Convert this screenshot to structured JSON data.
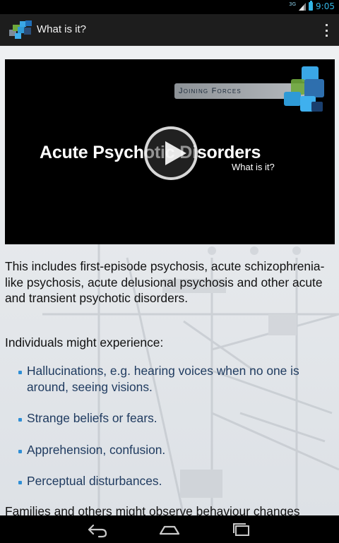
{
  "status_bar": {
    "network_label": "3G",
    "time": "9:05",
    "accent_color": "#33b5e5"
  },
  "action_bar": {
    "title": "What is it?",
    "app_icon": "joining-forces-logo-icon",
    "overflow_icon": "overflow-menu-icon"
  },
  "video": {
    "banner": "Joining Forces",
    "title": "Acute Psychotic Disorders",
    "subtitle": "What is it?",
    "play_icon": "play-icon"
  },
  "content": {
    "intro": "This includes first-episode psychosis, acute schizophrenia-like psychosis, acute delusional psychosis and other acute and transient psychotic disorders.",
    "lead": "Individuals might experience:",
    "bullets": [
      "Hallucinations, e.g. hearing voices when no one is around, seeing visions.",
      "Strange beliefs or fears.",
      "Apprehension, confusion.",
      "Perceptual disturbances."
    ],
    "outro": "Families and others might observe behaviour changes"
  },
  "nav_bar": {
    "back_icon": "back-icon",
    "home_icon": "home-icon",
    "recents_icon": "recent-apps-icon"
  }
}
